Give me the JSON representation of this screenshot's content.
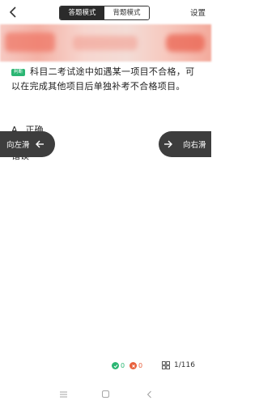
{
  "topbar": {
    "back_icon": "chevron-left-icon",
    "modes": [
      {
        "label": "答题模式",
        "active": true
      },
      {
        "label": "背题模式",
        "active": false
      }
    ],
    "settings_label": "设置"
  },
  "question": {
    "type_badge": "判断",
    "text": "科目二考试途中如遇某一项目不合格，可以在完成其他项目后单独补考不合格项目。"
  },
  "options": {
    "a_letter": "A",
    "a_text": "正确",
    "b_text": "错误"
  },
  "swipe": {
    "left_label": "向左滑",
    "right_label": "向右滑"
  },
  "stats": {
    "correct_count": "0",
    "wrong_count": "0",
    "progress": "1/116"
  },
  "colors": {
    "accent_green": "#2bb673",
    "wrong_orange": "#e8603c",
    "dark": "#3d3d3d"
  },
  "system_nav": [
    "menu-icon",
    "home-icon",
    "back-icon"
  ]
}
